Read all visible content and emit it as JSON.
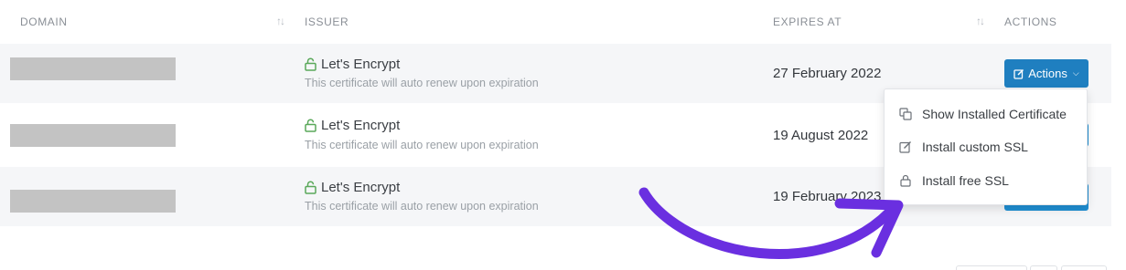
{
  "table": {
    "headers": {
      "domain": "DOMAIN",
      "issuer": "ISSUER",
      "expires_at": "EXPIRES AT",
      "actions": "ACTIONS"
    },
    "sort_icons": [
      "sort-icon",
      "sort-icon"
    ],
    "rows": [
      {
        "issuer": "Let's Encrypt",
        "note": "This certificate will auto renew upon expiration",
        "expires": "27 February 2022"
      },
      {
        "issuer": "Let's Encrypt",
        "note": "This certificate will auto renew upon expiration",
        "expires": "19 August 2022"
      },
      {
        "issuer": "Let's Encrypt",
        "note": "This certificate will auto renew upon expiration",
        "expires": "19 February 2023"
      }
    ]
  },
  "actions_button": {
    "label": "Actions",
    "color": "#1f7fc0"
  },
  "dropdown": {
    "items": [
      {
        "label": "Show Installed Certificate",
        "icon": "copy-icon"
      },
      {
        "label": "Install custom SSL",
        "icon": "edit-icon"
      },
      {
        "label": "Install free SSL",
        "icon": "lock-icon"
      }
    ]
  },
  "colors": {
    "lock_green": "#5aa85a",
    "arrow_purple": "#6a2fe0",
    "row_alt": "#f5f6f8"
  }
}
